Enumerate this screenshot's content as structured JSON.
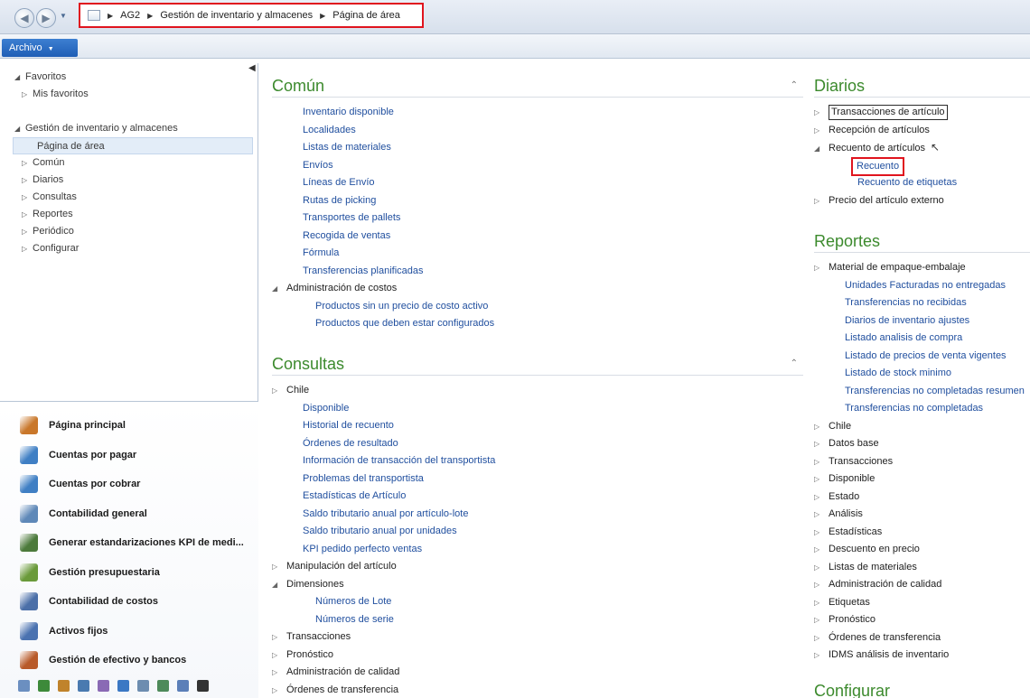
{
  "breadcrumb": {
    "items": [
      "AG2",
      "Gestión de inventario y almacenes",
      "Página de área"
    ]
  },
  "ribbon": {
    "file_label": "Archivo"
  },
  "navpane": {
    "tree": [
      {
        "label": "Favoritos",
        "level": 0,
        "glyph": "◢"
      },
      {
        "label": "Mis favoritos",
        "level": 1,
        "glyph": "▷"
      },
      {
        "label": "",
        "level": -1,
        "glyph": ""
      },
      {
        "label": "Gestión de inventario y almacenes",
        "level": 0,
        "glyph": "◢"
      },
      {
        "label": "Página de área",
        "level": 2,
        "glyph": ""
      },
      {
        "label": "Común",
        "level": 1,
        "glyph": "▷"
      },
      {
        "label": "Diarios",
        "level": 1,
        "glyph": "▷"
      },
      {
        "label": "Consultas",
        "level": 1,
        "glyph": "▷"
      },
      {
        "label": "Reportes",
        "level": 1,
        "glyph": "▷"
      },
      {
        "label": "Periódico",
        "level": 1,
        "glyph": "▷"
      },
      {
        "label": "Configurar",
        "level": 1,
        "glyph": "▷"
      }
    ],
    "modules": [
      {
        "label": "Página principal",
        "icon": "home-icon",
        "color": "#c9772a"
      },
      {
        "label": "Cuentas por pagar",
        "icon": "accounts-payable-icon",
        "color": "#3f7fc4"
      },
      {
        "label": "Cuentas por cobrar",
        "icon": "accounts-receivable-icon",
        "color": "#3f7fc4"
      },
      {
        "label": "Contabilidad general",
        "icon": "general-ledger-icon",
        "color": "#5e88b8"
      },
      {
        "label": "Generar estandarizaciones KPI de medi...",
        "icon": "kpi-icon",
        "color": "#4c7a3b"
      },
      {
        "label": "Gestión presupuestaria",
        "icon": "budget-icon",
        "color": "#6a9a3a"
      },
      {
        "label": "Contabilidad de costos",
        "icon": "cost-accounting-icon",
        "color": "#4b6fa8"
      },
      {
        "label": "Activos fijos",
        "icon": "fixed-assets-icon",
        "color": "#4a72b0"
      },
      {
        "label": "Gestión de efectivo y bancos",
        "icon": "cash-bank-icon",
        "color": "#b85a2a"
      }
    ],
    "toolstrip_colors": [
      "#6b8fc0",
      "#3d8a3a",
      "#c0832b",
      "#4a7ab0",
      "#8a6ab5",
      "#3b78c4",
      "#6d8db0",
      "#4e8a5a",
      "#5b7fb8",
      "#333333"
    ]
  },
  "comun": {
    "title": "Común",
    "items": [
      {
        "label": "Inventario disponible",
        "indent": 1,
        "glyph": "",
        "plain": false
      },
      {
        "label": "Localidades",
        "indent": 1,
        "glyph": "",
        "plain": false
      },
      {
        "label": "Listas de materiales",
        "indent": 1,
        "glyph": "",
        "plain": false
      },
      {
        "label": "Envíos",
        "indent": 1,
        "glyph": "",
        "plain": false
      },
      {
        "label": "Líneas de Envío",
        "indent": 1,
        "glyph": "",
        "plain": false
      },
      {
        "label": "Rutas de picking",
        "indent": 1,
        "glyph": "",
        "plain": false
      },
      {
        "label": "Transportes de pallets",
        "indent": 1,
        "glyph": "",
        "plain": false
      },
      {
        "label": "Recogida de ventas",
        "indent": 1,
        "glyph": "",
        "plain": false
      },
      {
        "label": "Fórmula",
        "indent": 1,
        "glyph": "",
        "plain": false
      },
      {
        "label": "Transferencias planificadas",
        "indent": 1,
        "glyph": "",
        "plain": false
      },
      {
        "label": "Administración de costos",
        "indent": 0,
        "glyph": "◢",
        "plain": true
      },
      {
        "label": "Productos sin un precio de costo activo",
        "indent": 3,
        "glyph": "",
        "plain": false
      },
      {
        "label": "Productos que deben estar configurados",
        "indent": 3,
        "glyph": "",
        "plain": false
      }
    ]
  },
  "consultas": {
    "title": "Consultas",
    "items": [
      {
        "label": "Chile",
        "indent": 0,
        "glyph": "▷",
        "plain": true
      },
      {
        "label": "Disponible",
        "indent": 1,
        "glyph": "",
        "plain": false
      },
      {
        "label": "Historial de recuento",
        "indent": 1,
        "glyph": "",
        "plain": false
      },
      {
        "label": "Órdenes de resultado",
        "indent": 1,
        "glyph": "",
        "plain": false
      },
      {
        "label": "Información de transacción del transportista",
        "indent": 1,
        "glyph": "",
        "plain": false
      },
      {
        "label": "Problemas del transportista",
        "indent": 1,
        "glyph": "",
        "plain": false
      },
      {
        "label": "Estadísticas de Artículo",
        "indent": 1,
        "glyph": "",
        "plain": false
      },
      {
        "label": "Saldo tributario anual por artículo-lote",
        "indent": 1,
        "glyph": "",
        "plain": false
      },
      {
        "label": "Saldo tributario anual por unidades",
        "indent": 1,
        "glyph": "",
        "plain": false
      },
      {
        "label": "KPI pedido perfecto ventas",
        "indent": 1,
        "glyph": "",
        "plain": false
      },
      {
        "label": "Manipulación del artículo",
        "indent": 0,
        "glyph": "▷",
        "plain": true
      },
      {
        "label": "Dimensiones",
        "indent": 0,
        "glyph": "◢",
        "plain": true
      },
      {
        "label": "Números de Lote",
        "indent": 3,
        "glyph": "",
        "plain": false
      },
      {
        "label": "Números de serie",
        "indent": 3,
        "glyph": "",
        "plain": false
      },
      {
        "label": "Transacciones",
        "indent": 0,
        "glyph": "▷",
        "plain": true
      },
      {
        "label": "Pronóstico",
        "indent": 0,
        "glyph": "▷",
        "plain": true
      },
      {
        "label": "Administración de calidad",
        "indent": 0,
        "glyph": "▷",
        "plain": true
      },
      {
        "label": "Órdenes de transferencia",
        "indent": 0,
        "glyph": "▷",
        "plain": true
      }
    ]
  },
  "diarios": {
    "title": "Diarios",
    "items": [
      {
        "label": "Transacciones de artículo",
        "indent": 0,
        "glyph": "▷",
        "plain": true,
        "style": "boxed"
      },
      {
        "label": "Recepción de artículos",
        "indent": 0,
        "glyph": "▷",
        "plain": true
      },
      {
        "label": "Recuento de artículos",
        "indent": 0,
        "glyph": "◢",
        "plain": true,
        "style": "cursor"
      },
      {
        "label": "Recuento",
        "indent": 2,
        "glyph": "",
        "plain": false,
        "style": "redbox"
      },
      {
        "label": "Recuento de etiquetas",
        "indent": 3,
        "glyph": "",
        "plain": false
      },
      {
        "label": "Precio del artículo externo",
        "indent": 0,
        "glyph": "▷",
        "plain": true
      }
    ]
  },
  "reportes": {
    "title": "Reportes",
    "items": [
      {
        "label": "Material de empaque-embalaje",
        "indent": 0,
        "glyph": "▷",
        "plain": true
      },
      {
        "label": "Unidades Facturadas no entregadas",
        "indent": 1,
        "glyph": "",
        "plain": false
      },
      {
        "label": "Transferencias no recibidas",
        "indent": 1,
        "glyph": "",
        "plain": false
      },
      {
        "label": "Diarios de inventario ajustes",
        "indent": 1,
        "glyph": "",
        "plain": false
      },
      {
        "label": "Listado analisis de compra",
        "indent": 1,
        "glyph": "",
        "plain": false
      },
      {
        "label": "Listado de precios de venta vigentes",
        "indent": 1,
        "glyph": "",
        "plain": false
      },
      {
        "label": "Listado de stock minimo",
        "indent": 1,
        "glyph": "",
        "plain": false
      },
      {
        "label": "Transferencias no completadas resumen",
        "indent": 1,
        "glyph": "",
        "plain": false
      },
      {
        "label": "Transferencias no completadas",
        "indent": 1,
        "glyph": "",
        "plain": false
      },
      {
        "label": "Chile",
        "indent": 0,
        "glyph": "▷",
        "plain": true
      },
      {
        "label": "Datos base",
        "indent": 0,
        "glyph": "▷",
        "plain": true
      },
      {
        "label": "Transacciones",
        "indent": 0,
        "glyph": "▷",
        "plain": true
      },
      {
        "label": "Disponible",
        "indent": 0,
        "glyph": "▷",
        "plain": true
      },
      {
        "label": "Estado",
        "indent": 0,
        "glyph": "▷",
        "plain": true
      },
      {
        "label": "Análisis",
        "indent": 0,
        "glyph": "▷",
        "plain": true
      },
      {
        "label": "Estadísticas",
        "indent": 0,
        "glyph": "▷",
        "plain": true
      },
      {
        "label": "Descuento en precio",
        "indent": 0,
        "glyph": "▷",
        "plain": true
      },
      {
        "label": "Listas de materiales",
        "indent": 0,
        "glyph": "▷",
        "plain": true
      },
      {
        "label": "Administración de calidad",
        "indent": 0,
        "glyph": "▷",
        "plain": true
      },
      {
        "label": "Etiquetas",
        "indent": 0,
        "glyph": "▷",
        "plain": true
      },
      {
        "label": "Pronóstico",
        "indent": 0,
        "glyph": "▷",
        "plain": true
      },
      {
        "label": "Órdenes de transferencia",
        "indent": 0,
        "glyph": "▷",
        "plain": true
      },
      {
        "label": "IDMS análisis de inventario",
        "indent": 0,
        "glyph": "▷",
        "plain": true
      }
    ]
  },
  "configurar": {
    "title": "Configurar"
  }
}
